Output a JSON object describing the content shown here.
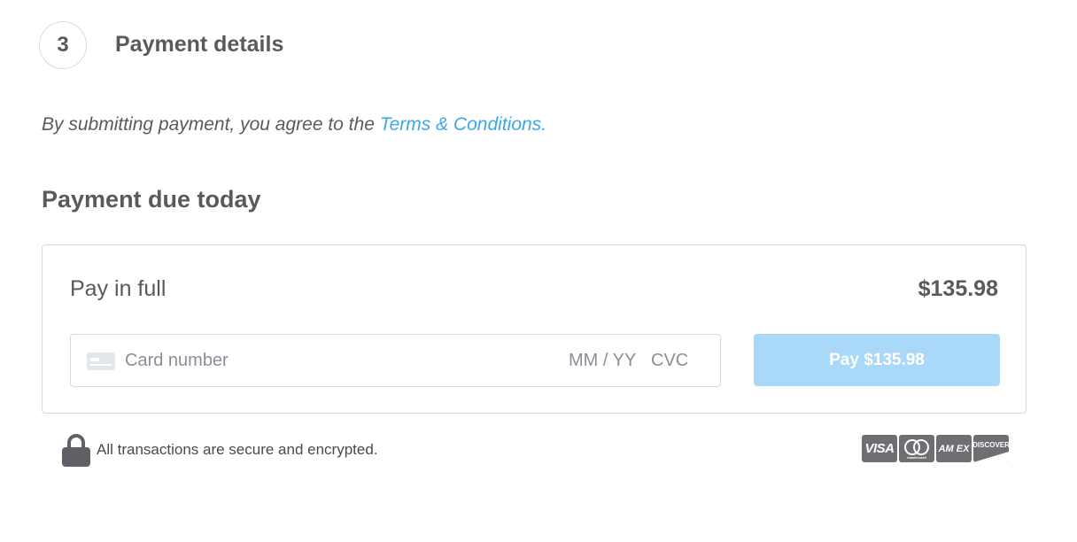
{
  "step": {
    "number": "3",
    "title": "Payment details"
  },
  "terms": {
    "prefix": "By submitting payment, you agree to the ",
    "link": "Terms & Conditions."
  },
  "due": {
    "title": "Payment due today"
  },
  "payment": {
    "option_label": "Pay in full",
    "amount": "$135.98",
    "card_placeholder": "Card number",
    "expiry_placeholder": "MM / YY",
    "cvc_placeholder": "CVC",
    "pay_button_label": "Pay $135.98"
  },
  "security": {
    "text": "All transactions are secure and encrypted."
  },
  "card_brands": {
    "visa": "VISA",
    "mastercard": "mastercard",
    "amex": "AM EX",
    "discover": "DISCOVER"
  },
  "colors": {
    "link": "#3ba7e8",
    "pay_button_bg": "#a9d8f8",
    "text": "#5a5a5a",
    "border": "#d9d9d9"
  },
  "icons": [
    "card-icon",
    "lock-icon",
    "visa-icon",
    "mastercard-icon",
    "amex-icon",
    "discover-icon"
  ]
}
